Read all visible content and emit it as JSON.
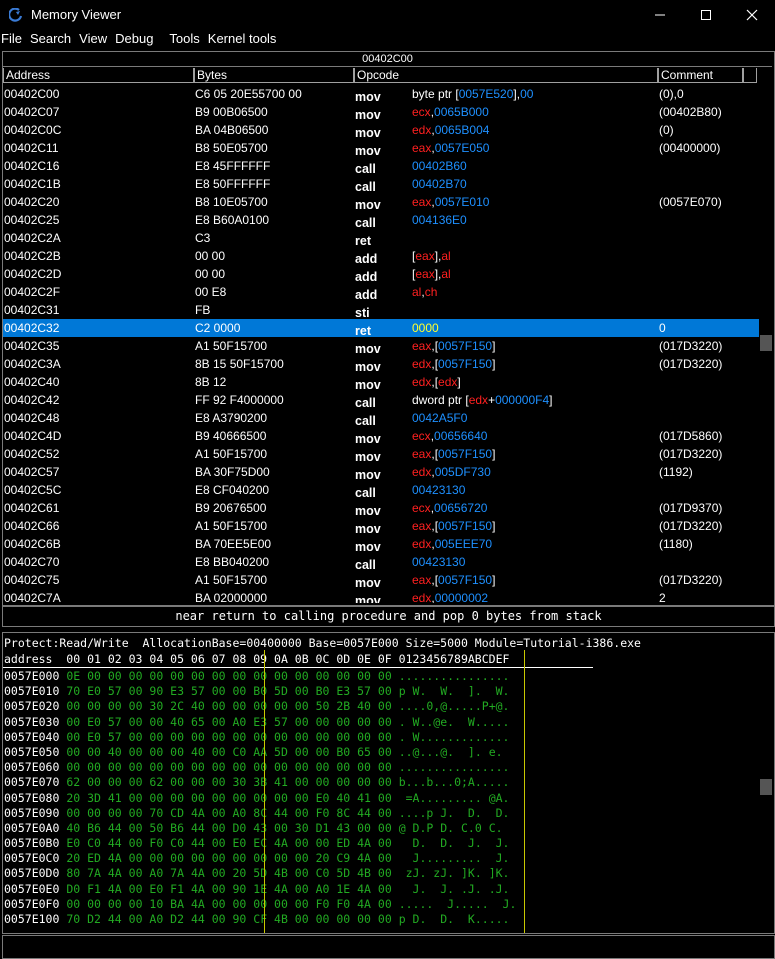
{
  "window": {
    "title": "Memory Viewer"
  },
  "menu": [
    "File",
    "Search",
    "View",
    "Debug",
    "Tools",
    "Kernel tools"
  ],
  "disasm": {
    "top_address": "00402C00",
    "columns": [
      "Address",
      "Bytes",
      "Opcode",
      "Comment"
    ],
    "rows": [
      {
        "addr": "00402C00",
        "bytes": "C6 05 20E55700 00",
        "op": "mov",
        "args": [
          [
            "byte ptr [",
            "w"
          ],
          [
            "0057E520",
            "b"
          ],
          [
            "],",
            "w"
          ],
          [
            "00",
            "b"
          ]
        ],
        "cmt": "(0),0"
      },
      {
        "addr": "00402C07",
        "bytes": "B9 00B06500",
        "op": "mov",
        "args": [
          [
            "ecx",
            "r"
          ],
          [
            ",",
            "w"
          ],
          [
            "0065B000",
            "b"
          ]
        ],
        "cmt": "(00402B80)"
      },
      {
        "addr": "00402C0C",
        "bytes": "BA 04B06500",
        "op": "mov",
        "args": [
          [
            "edx",
            "r"
          ],
          [
            ",",
            "w"
          ],
          [
            "0065B004",
            "b"
          ]
        ],
        "cmt": "(0)"
      },
      {
        "addr": "00402C11",
        "bytes": "B8 50E05700",
        "op": "mov",
        "args": [
          [
            "eax",
            "r"
          ],
          [
            ",",
            "w"
          ],
          [
            "0057E050",
            "b"
          ]
        ],
        "cmt": "(00400000)"
      },
      {
        "addr": "00402C16",
        "bytes": "E8 45FFFFFF",
        "op": "call",
        "args": [
          [
            "00402B60",
            "b"
          ]
        ],
        "cmt": ""
      },
      {
        "addr": "00402C1B",
        "bytes": "E8 50FFFFFF",
        "op": "call",
        "args": [
          [
            "00402B70",
            "b"
          ]
        ],
        "cmt": ""
      },
      {
        "addr": "00402C20",
        "bytes": "B8 10E05700",
        "op": "mov",
        "args": [
          [
            "eax",
            "r"
          ],
          [
            ",",
            "w"
          ],
          [
            "0057E010",
            "b"
          ]
        ],
        "cmt": "(0057E070)"
      },
      {
        "addr": "00402C25",
        "bytes": "E8 B60A0100",
        "op": "call",
        "args": [
          [
            "004136E0",
            "b"
          ]
        ],
        "cmt": ""
      },
      {
        "addr": "00402C2A",
        "bytes": "C3",
        "op": "ret",
        "args": [],
        "cmt": ""
      },
      {
        "addr": "00402C2B",
        "bytes": "00 00",
        "op": "add",
        "args": [
          [
            "[",
            "w"
          ],
          [
            "eax",
            "r"
          ],
          [
            "],",
            "w"
          ],
          [
            "al",
            "r"
          ]
        ],
        "cmt": ""
      },
      {
        "addr": "00402C2D",
        "bytes": "00 00",
        "op": "add",
        "args": [
          [
            "[",
            "w"
          ],
          [
            "eax",
            "r"
          ],
          [
            "],",
            "w"
          ],
          [
            "al",
            "r"
          ]
        ],
        "cmt": ""
      },
      {
        "addr": "00402C2F",
        "bytes": "00 E8",
        "op": "add",
        "args": [
          [
            "al",
            "r"
          ],
          [
            ",",
            "w"
          ],
          [
            "ch",
            "r"
          ]
        ],
        "cmt": ""
      },
      {
        "addr": "00402C31",
        "bytes": "FB",
        "op": "sti",
        "args": [],
        "cmt": ""
      },
      {
        "addr": "00402C32",
        "bytes": "C2 0000",
        "op": "ret",
        "args": [
          [
            "0000",
            "y"
          ]
        ],
        "cmt": "0",
        "selected": true
      },
      {
        "addr": "00402C35",
        "bytes": "A1 50F15700",
        "op": "mov",
        "args": [
          [
            "eax",
            "r"
          ],
          [
            ",[",
            "w"
          ],
          [
            "0057F150",
            "b"
          ],
          [
            "]",
            "w"
          ]
        ],
        "cmt": "(017D3220)"
      },
      {
        "addr": "00402C3A",
        "bytes": "8B 15 50F15700",
        "op": "mov",
        "args": [
          [
            "edx",
            "r"
          ],
          [
            ",[",
            "w"
          ],
          [
            "0057F150",
            "b"
          ],
          [
            "]",
            "w"
          ]
        ],
        "cmt": "(017D3220)"
      },
      {
        "addr": "00402C40",
        "bytes": "8B 12",
        "op": "mov",
        "args": [
          [
            "edx",
            "r"
          ],
          [
            ",[",
            "w"
          ],
          [
            "edx",
            "r"
          ],
          [
            "]",
            "w"
          ]
        ],
        "cmt": ""
      },
      {
        "addr": "00402C42",
        "bytes": "FF 92 F4000000",
        "op": "call",
        "args": [
          [
            "dword ptr [",
            "w"
          ],
          [
            "edx",
            "r"
          ],
          [
            "+",
            "w"
          ],
          [
            "000000F4",
            "b"
          ],
          [
            "]",
            "w"
          ]
        ],
        "cmt": ""
      },
      {
        "addr": "00402C48",
        "bytes": "E8 A3790200",
        "op": "call",
        "args": [
          [
            "0042A5F0",
            "b"
          ]
        ],
        "cmt": ""
      },
      {
        "addr": "00402C4D",
        "bytes": "B9 40666500",
        "op": "mov",
        "args": [
          [
            "ecx",
            "r"
          ],
          [
            ",",
            "w"
          ],
          [
            "00656640",
            "b"
          ]
        ],
        "cmt": "(017D5860)"
      },
      {
        "addr": "00402C52",
        "bytes": "A1 50F15700",
        "op": "mov",
        "args": [
          [
            "eax",
            "r"
          ],
          [
            ",[",
            "w"
          ],
          [
            "0057F150",
            "b"
          ],
          [
            "]",
            "w"
          ]
        ],
        "cmt": "(017D3220)"
      },
      {
        "addr": "00402C57",
        "bytes": "BA 30F75D00",
        "op": "mov",
        "args": [
          [
            "edx",
            "r"
          ],
          [
            ",",
            "w"
          ],
          [
            "005DF730",
            "b"
          ]
        ],
        "cmt": "(1192)"
      },
      {
        "addr": "00402C5C",
        "bytes": "E8 CF040200",
        "op": "call",
        "args": [
          [
            "00423130",
            "b"
          ]
        ],
        "cmt": ""
      },
      {
        "addr": "00402C61",
        "bytes": "B9 20676500",
        "op": "mov",
        "args": [
          [
            "ecx",
            "r"
          ],
          [
            ",",
            "w"
          ],
          [
            "00656720",
            "b"
          ]
        ],
        "cmt": "(017D9370)"
      },
      {
        "addr": "00402C66",
        "bytes": "A1 50F15700",
        "op": "mov",
        "args": [
          [
            "eax",
            "r"
          ],
          [
            ",[",
            "w"
          ],
          [
            "0057F150",
            "b"
          ],
          [
            "]",
            "w"
          ]
        ],
        "cmt": "(017D3220)"
      },
      {
        "addr": "00402C6B",
        "bytes": "BA 70EE5E00",
        "op": "mov",
        "args": [
          [
            "edx",
            "r"
          ],
          [
            ",",
            "w"
          ],
          [
            "005EEE70",
            "b"
          ]
        ],
        "cmt": "(1180)"
      },
      {
        "addr": "00402C70",
        "bytes": "E8 BB040200",
        "op": "call",
        "args": [
          [
            "00423130",
            "b"
          ]
        ],
        "cmt": ""
      },
      {
        "addr": "00402C75",
        "bytes": "A1 50F15700",
        "op": "mov",
        "args": [
          [
            "eax",
            "r"
          ],
          [
            ",[",
            "w"
          ],
          [
            "0057F150",
            "b"
          ],
          [
            "]",
            "w"
          ]
        ],
        "cmt": "(017D3220)"
      },
      {
        "addr": "00402C7A",
        "bytes": "BA 02000000",
        "op": "mov",
        "args": [
          [
            "edx",
            "r"
          ],
          [
            ",",
            "w"
          ],
          [
            "00000002",
            "b"
          ]
        ],
        "cmt": "2"
      }
    ]
  },
  "status": {
    "text": "near return to calling procedure and pop 0 bytes from stack"
  },
  "hex": {
    "info": "Protect:Read/Write  AllocationBase=00400000 Base=0057E000 Size=5000 Module=Tutorial-i386.exe",
    "header": "address  00 01 02 03 04 05 06 07 08 09 0A 0B 0C 0D 0E 0F 0123456789ABCDEF",
    "rows": [
      {
        "addr": "0057E000",
        "bytes": "0E 00 00 00 00 00 00 00 00 00 00 00 00 00 00 00",
        "ascii": "................"
      },
      {
        "addr": "0057E010",
        "bytes": "70 E0 57 00 90 E3 57 00 00 B0 5D 00 B0 E3 57 00",
        "ascii": "p W.  W.  ].  W."
      },
      {
        "addr": "0057E020",
        "bytes": "00 00 00 00 30 2C 40 00 00 00 00 00 50 2B 40 00",
        "ascii": "....0,@.....P+@."
      },
      {
        "addr": "0057E030",
        "bytes": "00 E0 57 00 00 40 65 00 A0 E3 57 00 00 00 00 00",
        "ascii": ". W..@e.  W....."
      },
      {
        "addr": "0057E040",
        "bytes": "00 E0 57 00 00 00 00 00 00 00 00 00 00 00 00 00",
        "ascii": ". W............."
      },
      {
        "addr": "0057E050",
        "bytes": "00 00 40 00 00 00 40 00 C0 AA 5D 00 00 B0 65 00",
        "ascii": "..@...@.  ]. e."
      },
      {
        "addr": "0057E060",
        "bytes": "00 00 00 00 00 00 00 00 00 00 00 00 00 00 00 00",
        "ascii": "................"
      },
      {
        "addr": "0057E070",
        "bytes": "62 00 00 00 62 00 00 00 30 3B 41 00 00 00 00 00",
        "ascii": "b...b...0;A....."
      },
      {
        "addr": "0057E080",
        "bytes": "20 3D 41 00 00 00 00 00 00 00 00 00 E0 40 41 00",
        "ascii": " =A......... @A."
      },
      {
        "addr": "0057E090",
        "bytes": "00 00 00 00 70 CD 4A 00 A0 8C 44 00 F0 8C 44 00",
        "ascii": "....p J.  D.  D."
      },
      {
        "addr": "0057E0A0",
        "bytes": "40 B6 44 00 50 B6 44 00 D0 43 00 30 D1 43 00 00",
        "ascii": "@ D.P D. C.0 C."
      },
      {
        "addr": "0057E0B0",
        "bytes": "E0 C0 44 00 F0 C0 44 00 E0 EC 4A 00 00 ED 4A 00",
        "ascii": "  D.  D.  J.  J."
      },
      {
        "addr": "0057E0C0",
        "bytes": "20 ED 4A 00 00 00 00 00 00 00 00 00 20 C9 4A 00",
        "ascii": "  J.........  J."
      },
      {
        "addr": "0057E0D0",
        "bytes": "80 7A 4A 00 A0 7A 4A 00 20 5D 4B 00 C0 5D 4B 00",
        "ascii": " zJ. zJ. ]K. ]K."
      },
      {
        "addr": "0057E0E0",
        "bytes": "D0 F1 4A 00 E0 F1 4A 00 90 1E 4A 00 A0 1E 4A 00",
        "ascii": "  J.  J. .J. .J."
      },
      {
        "addr": "0057E0F0",
        "bytes": "00 00 00 00 10 BA 4A 00 00 00 00 00 F0 F0 4A 00",
        "ascii": ".....  J.....  J."
      },
      {
        "addr": "0057E100",
        "bytes": "70 D2 44 00 A0 D2 44 00 90 CF 4B 00 00 00 00 00",
        "ascii": "p D.  D.  K....."
      }
    ]
  }
}
